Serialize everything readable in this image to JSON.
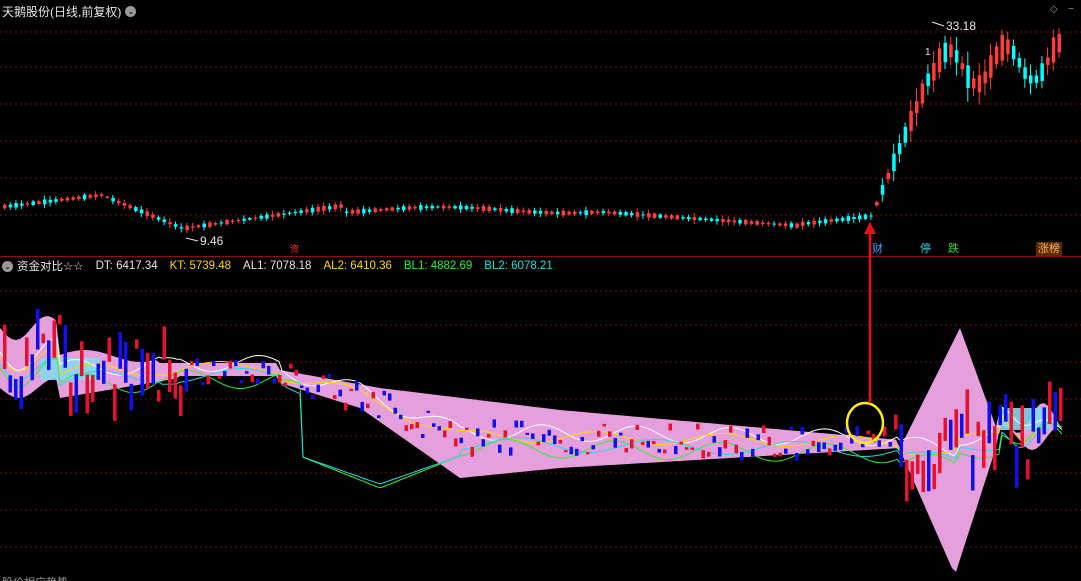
{
  "header": {
    "stock_title": "天鹅股份(日线,前复权)",
    "dropdown_symbol": "⌄",
    "corner_symbol": "◇",
    "corner_minimize": "−"
  },
  "price_annotations": {
    "high_label": "33.18",
    "low_label": "9.46",
    "one_marker": "1"
  },
  "event_tags": [
    {
      "label": "资",
      "color": "#ff3030"
    },
    {
      "label": "财",
      "color": "#3aa0ff"
    },
    {
      "label": "停",
      "color": "#3ad0e0"
    },
    {
      "label": "跌",
      "color": "#33dd33"
    },
    {
      "label": "涨榜",
      "color": "#ff4040"
    }
  ],
  "indicator": {
    "name": "资金对比☆☆",
    "values": [
      {
        "label": "DT: 6417.34",
        "color": "#e6e6e6"
      },
      {
        "label": "KT: 5739.48",
        "color": "#ffd700"
      },
      {
        "label": "AL1: 7078.18",
        "color": "#e6e6e6"
      },
      {
        "label": "AL2: 6410.36",
        "color": "#ffd700"
      },
      {
        "label": "BL1: 4882.69",
        "color": "#33ee33"
      },
      {
        "label": "BL2: 6078.21",
        "color": "#22dddd"
      }
    ],
    "bottom_label": "股价相应趋势"
  },
  "colors": {
    "up": "#ff3c3c",
    "down": "#00ffff",
    "band": "#f0a8e8",
    "band_light": "#87d8f0",
    "bar_up": "#e8102a",
    "bar_down": "#1010ee",
    "grid": "#6a0f0f",
    "highlight_circle": "#ffee00",
    "arrow": "#ee1010"
  },
  "chart_data": {
    "type": "candlestick",
    "title": "天鹅股份(日线,前复权)",
    "price_high": 33.18,
    "price_low": 9.46,
    "indicator_series": [
      "DT",
      "KT",
      "AL1",
      "AL2",
      "BL1",
      "BL2"
    ],
    "indicator_latest": {
      "DT": 6417.34,
      "KT": 5739.48,
      "AL1": 7078.18,
      "AL2": 6410.36,
      "BL1": 4882.69,
      "BL2": 6078.21
    }
  }
}
